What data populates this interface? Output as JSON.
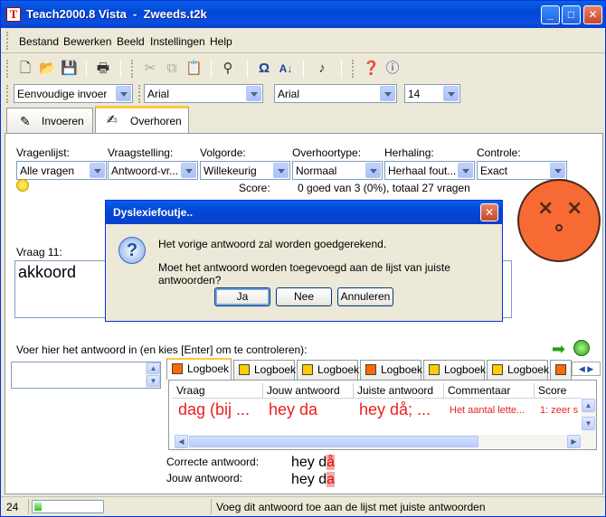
{
  "window": {
    "title": "Teach2000.8 Vista  -  Zweeds.t2k",
    "icon_glyph": "T"
  },
  "menu": [
    "Bestand",
    "Bewerken",
    "Beeld",
    "Instellingen",
    "Help"
  ],
  "toolbar2": {
    "mode": "Eenvoudige invoer",
    "font1": "Arial",
    "font2": "Arial",
    "size": "14"
  },
  "tabs": [
    {
      "label": "Invoeren"
    },
    {
      "label": "Overhoren"
    }
  ],
  "filters": {
    "labels": [
      "Vragenlijst:",
      "Vraagstelling:",
      "Volgorde:",
      "Overhoortype:",
      "Herhaling:",
      "Controle:"
    ],
    "values": [
      "Alle vragen",
      "Antwoord-vr...",
      "Willekeurig",
      "Normaal",
      "Herhaal fout...",
      "Exact"
    ]
  },
  "score": {
    "label": "Score:",
    "value": "0 goed van 3 (0%), totaal 27 vragen"
  },
  "question": {
    "label": "Vraag 11:",
    "text": "akkoord"
  },
  "answer_prompt": "Voer hier het antwoord in (en kies [Enter] om te controleren):",
  "logbook": {
    "tab_label": "Logboek",
    "tab_colors": [
      "#ff6a00",
      "#ffcc00",
      "#ffcc00",
      "#ff6a00",
      "#ffcc00",
      "#ffcc00",
      "#ff6a00"
    ],
    "columns": [
      "Vraag",
      "Jouw antwoord",
      "Juiste antwoord",
      "Commentaar",
      "Score"
    ],
    "row": [
      "dag (bij ...",
      "hey da",
      "hey då; ...",
      "Het aantal lette...",
      "1: zeer s"
    ]
  },
  "comparison": {
    "correct_label": "Correcte antwoord:",
    "user_label": "Jouw antwoord:",
    "correct_prefix": "hey d",
    "correct_diff": "å",
    "user_prefix": "hey d",
    "user_diff": "a"
  },
  "status": {
    "number": "24",
    "progress": 0.1,
    "message": "Voeg dit antwoord toe aan de lijst met juiste antwoorden"
  },
  "dialog": {
    "title": "Dyslexiefoutje..",
    "line1": "Het vorige antwoord zal worden goedgerekend.",
    "line2": "Moet het antwoord worden toegevoegd aan de lijst van juiste antwoorden?",
    "buttons": [
      "Ja",
      "Nee",
      "Annuleren"
    ]
  }
}
